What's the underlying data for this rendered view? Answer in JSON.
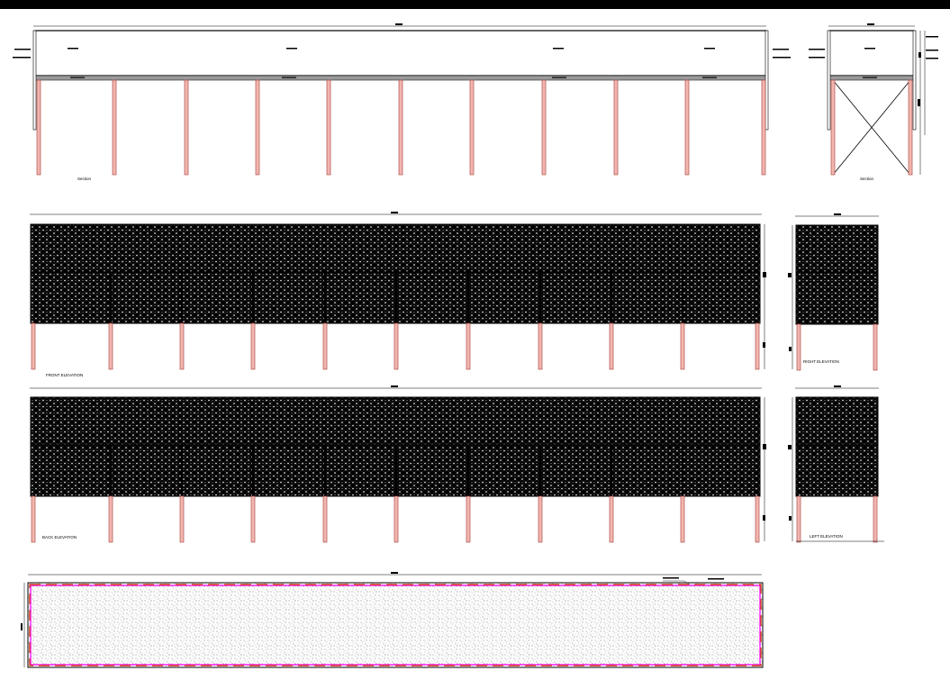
{
  "labels": {
    "section_long": "Section",
    "section_short": "Section",
    "front": "FRONT ELEVATION",
    "right": "RIGHT ELEVATION",
    "back": "BACK ELEVATION",
    "left": "LEFT ELEVATION"
  },
  "colors": {
    "post_fill": "#f2b6b0",
    "post_stroke": "#b0504a",
    "mesh_bg": "#000000",
    "mesh_dot": "#ffffff",
    "plan_border": "#ff00ff",
    "plan_dash": "#d0401a"
  }
}
